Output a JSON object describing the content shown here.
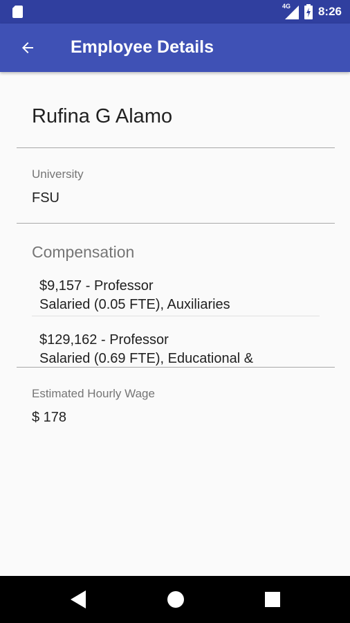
{
  "status_bar": {
    "network": "4G",
    "time": "8:26"
  },
  "app_bar": {
    "title": "Employee Details"
  },
  "employee": {
    "name": "Rufina G Alamo",
    "university_label": "University",
    "university": "FSU",
    "compensation_title": "Compensation",
    "compensation": [
      {
        "line1": "$9,157 - Professor",
        "line2": "Salaried (0.05 FTE), Auxiliaries"
      },
      {
        "line1": "$129,162 - Professor",
        "line2": "Salaried (0.69 FTE), Educational &"
      }
    ],
    "wage_label": "Estimated Hourly Wage",
    "wage": "$ 178"
  },
  "colors": {
    "status_bar": "#303f9f",
    "app_bar": "#3f51b5",
    "background": "#fafafa"
  },
  "icons": [
    "sim-card-icon",
    "signal-icon",
    "battery-charging-icon",
    "back-arrow-icon",
    "nav-back-icon",
    "nav-home-icon",
    "nav-recents-icon"
  ]
}
